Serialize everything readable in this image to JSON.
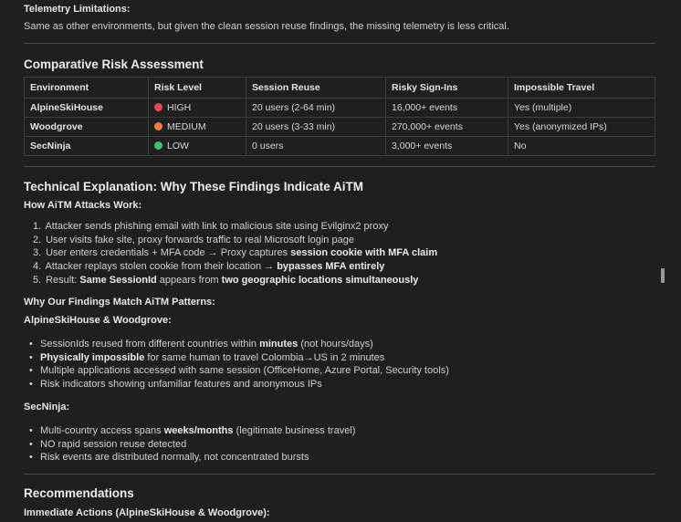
{
  "telemetry": {
    "heading": "Telemetry Limitations:",
    "text": "Same as other environments, but given the clean session reuse findings, the missing telemetry is less critical."
  },
  "risk": {
    "heading": "Comparative Risk Assessment",
    "columns": [
      "Environment",
      "Risk Level",
      "Session Reuse",
      "Risky Sign-Ins",
      "Impossible Travel"
    ],
    "rows": [
      {
        "env": "AlpineSkiHouse",
        "level": "HIGH",
        "dot_color": "#e8445a",
        "reuse": "20 users (2-64 min)",
        "signins": "16,000+ events",
        "travel": "Yes (multiple)"
      },
      {
        "env": "Woodgrove",
        "level": "MEDIUM",
        "dot_color": "#f07b3f",
        "reuse": "20 users (3-33 min)",
        "signins": "270,000+ events",
        "travel": "Yes (anonymized IPs)"
      },
      {
        "env": "SecNinja",
        "level": "LOW",
        "dot_color": "#3fc26a",
        "reuse": "0 users",
        "signins": "3,000+ events",
        "travel": "No"
      }
    ]
  },
  "technical": {
    "heading": "Technical Explanation: Why These Findings Indicate AiTM",
    "how_heading": "How AiTM Attacks Work:",
    "steps": [
      {
        "num": "1.",
        "pre": "Attacker sends phishing email with link to malicious site using Evilginx2 proxy",
        "bold": "",
        "post": ""
      },
      {
        "num": "2.",
        "pre": "User visits fake site, proxy forwards traffic to real Microsoft login page",
        "bold": "",
        "post": ""
      },
      {
        "num": "3.",
        "pre": "User enters credentials + MFA code → Proxy captures ",
        "bold": "session cookie with MFA claim",
        "post": ""
      },
      {
        "num": "4.",
        "pre": "Attacker replays stolen cookie from their location → ",
        "bold": "bypasses MFA entirely",
        "post": ""
      },
      {
        "num": "5.",
        "pre": "Result: ",
        "bold": "Same SessionId",
        "post": " appears from ",
        "bold2": "two geographic locations simultaneously"
      }
    ],
    "why_heading": "Why Our Findings Match AiTM Patterns:",
    "aw_heading": "AlpineSkiHouse & Woodgrove:",
    "aw_items": [
      {
        "pre": "SessionIds reused from different countries within ",
        "bold": "minutes",
        "post": " (not hours/days)"
      },
      {
        "pre": "",
        "bold": "Physically impossible",
        "post": " for same human to travel Colombia→US in 2 minutes"
      },
      {
        "pre": "Multiple applications accessed with same session (OfficeHome, Azure Portal, Security tools)",
        "bold": "",
        "post": ""
      },
      {
        "pre": "Risk indicators showing unfamiliar features and anonymous IPs",
        "bold": "",
        "post": ""
      }
    ],
    "sn_heading": "SecNinja:",
    "sn_items": [
      {
        "pre": "Multi-country access spans ",
        "bold": "weeks/months",
        "post": " (legitimate business travel)"
      },
      {
        "pre": "NO rapid session reuse detected",
        "bold": "",
        "post": ""
      },
      {
        "pre": "Risk events are distributed normally, not concentrated bursts",
        "bold": "",
        "post": ""
      }
    ]
  },
  "recommendations": {
    "heading": "Recommendations",
    "sub": "Immediate Actions (AlpineSkiHouse & Woodgrove):"
  }
}
